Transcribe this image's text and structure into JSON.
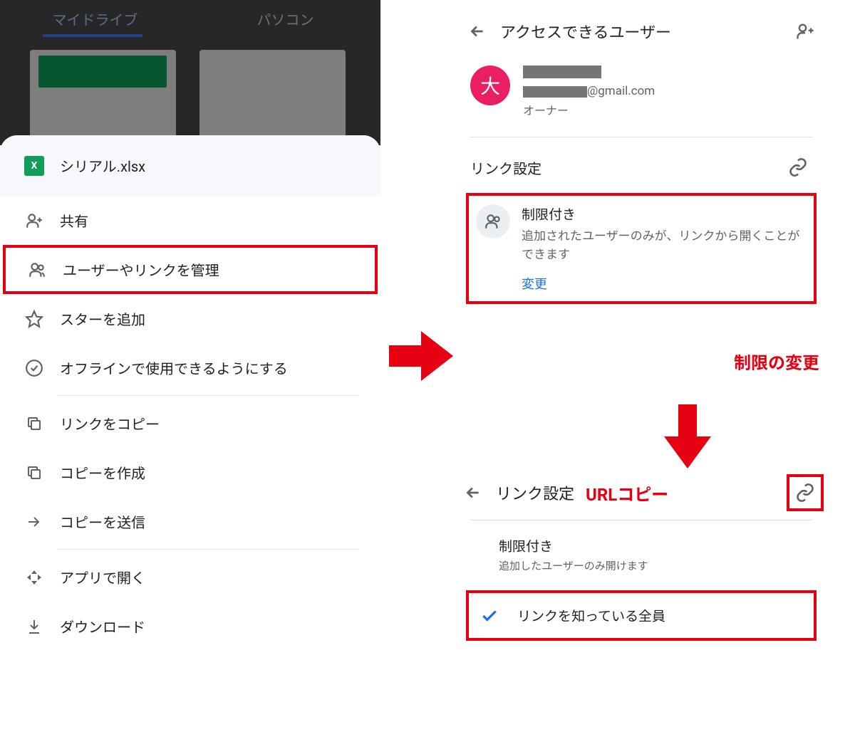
{
  "left": {
    "tabs": {
      "mydrive": "マイドライブ",
      "computer": "パソコン"
    },
    "file": {
      "icon_letter": "X",
      "name": "シリアル.xlsx"
    },
    "menu": {
      "share": "共有",
      "manage_access": "ユーザーやリンクを管理",
      "add_star": "スターを追加",
      "offline": "オフラインで使用できるようにする",
      "copy_link": "リンクをコピー",
      "make_copy": "コピーを作成",
      "send_copy": "コピーを送信",
      "open_with": "アプリで開く",
      "download": "ダウンロード"
    }
  },
  "right": {
    "header_title": "アクセスできるユーザー",
    "owner": {
      "avatar_letter": "大",
      "email_suffix": "@gmail.com",
      "role": "オーナー"
    },
    "link_settings_label": "リンク設定",
    "restricted": {
      "title": "制限付き",
      "desc": "追加されたユーザーのみが、リンクから開くことができます",
      "change": "変更"
    },
    "annotation_change": "制限の変更"
  },
  "popup": {
    "title": "リンク設定",
    "url_copy_label": "URLコピー",
    "restricted_title": "制限付き",
    "restricted_desc": "追加したユーザーのみ開けます",
    "anyone_with_link": "リンクを知っている全員"
  }
}
